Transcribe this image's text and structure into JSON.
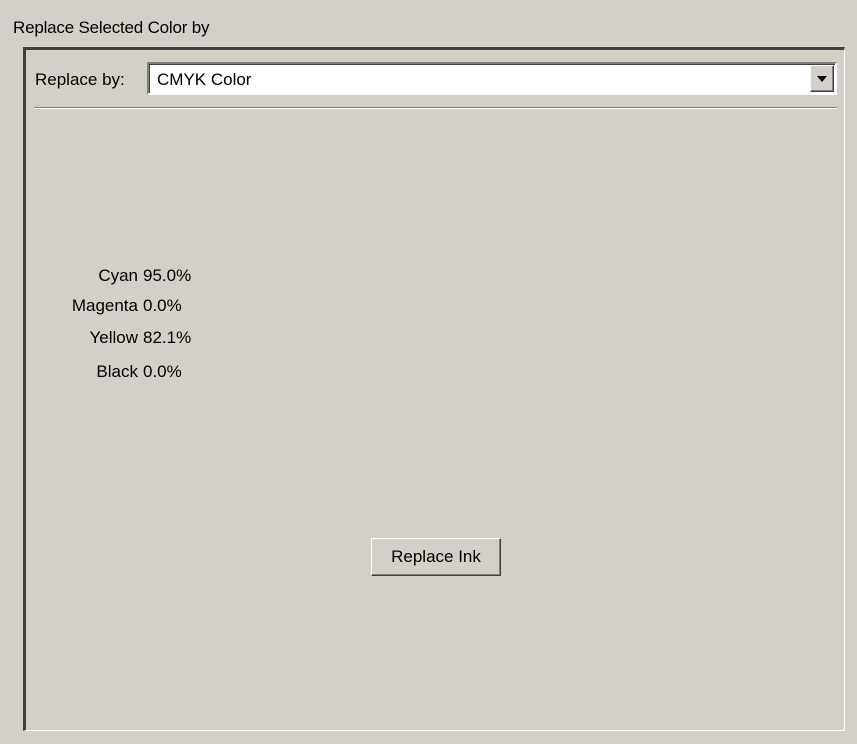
{
  "title": "Replace Selected Color by",
  "replace_by": {
    "label": "Replace by:",
    "selected": "CMYK Color"
  },
  "inks": [
    {
      "name": "Cyan",
      "value": "95.0%"
    },
    {
      "name": "Magenta",
      "value": "0.0%"
    },
    {
      "name": "Yellow",
      "value": "82.1%"
    },
    {
      "name": "Black",
      "value": "0.0%"
    }
  ],
  "replace_button_label": "Replace Ink"
}
